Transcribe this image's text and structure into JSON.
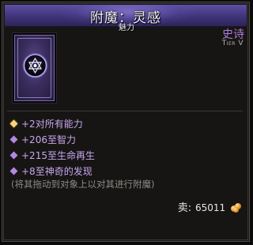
{
  "tooltip": {
    "title": "附魔：灵感",
    "subtitle": "魅力",
    "rarity": "史诗",
    "tier": "Tier V",
    "icon": "hexagram-card-icon",
    "stats": [
      {
        "text": "+2对所有能力",
        "bullet": "gold-diamond-icon"
      },
      {
        "text": "+206至智力",
        "bullet": "purple-diamond-icon"
      },
      {
        "text": "+215至生命再生",
        "bullet": "purple-diamond-icon"
      },
      {
        "text": "+8至神奇的发现",
        "bullet": "purple-diamond-icon"
      }
    ],
    "note": "(将其拖动到对象上以对其进行附魔)",
    "sell": {
      "label": "卖:",
      "value": "65011",
      "icon": "gold-coins-icon"
    }
  },
  "colors": {
    "header": "#4a3d8c",
    "rarity_epic": "#b07bdc",
    "stat_text": "#c9a6ee",
    "gold_bullet": "#f5d57a",
    "note_text": "#8d8a85"
  }
}
